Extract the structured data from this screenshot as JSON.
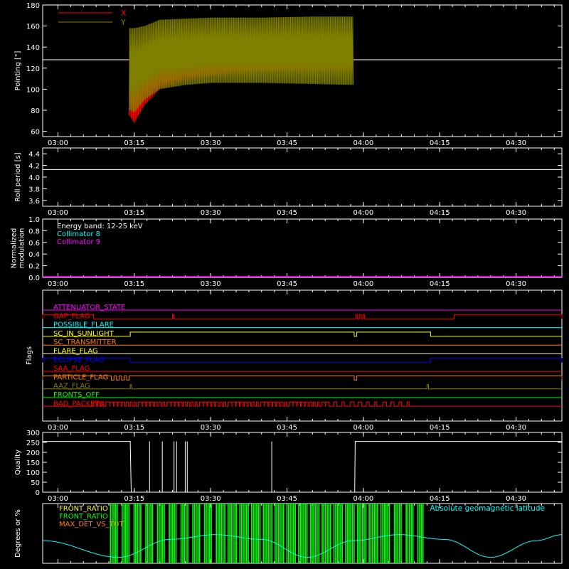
{
  "colors": {
    "background": "#000000",
    "axes": "#ffffff",
    "x_pointing": "#ff0000",
    "y_pointing": "#808000",
    "collimator8": "#00ffff",
    "collimator9": "#ff00ff",
    "front_ratio_1": "#ffff00",
    "front_ratio_2": "#00ff00",
    "max_det": "#ff8000",
    "geomag": "#00ffff"
  },
  "time_ticks": [
    "03:00",
    "03:15",
    "03:30",
    "03:45",
    "04:00",
    "04:15",
    "04:30"
  ],
  "chart_data": [
    {
      "type": "line",
      "ylabel": "Pointing [\"]",
      "ylim": [
        55,
        180
      ],
      "yticks": [
        "60",
        "80",
        "100",
        "120",
        "140",
        "160",
        "180"
      ],
      "legend": [
        {
          "name": "X",
          "color": "#ff0000"
        },
        {
          "name": "Y",
          "color": "#808000"
        }
      ],
      "reference_line": 128,
      "series": [
        {
          "name": "X",
          "x": [
            "03:14",
            "03:15",
            "03:17",
            "03:20",
            "03:25",
            "03:30",
            "03:40",
            "03:50",
            "03:58"
          ],
          "min": [
            75,
            68,
            85,
            100,
            108,
            112,
            116,
            117,
            118
          ],
          "max": [
            150,
            115,
            120,
            124,
            128,
            130,
            132,
            134,
            136
          ]
        },
        {
          "name": "Y",
          "x": [
            "03:14",
            "03:15",
            "03:17",
            "03:20",
            "03:25",
            "03:30",
            "03:40",
            "03:50",
            "03:58"
          ],
          "min": [
            80,
            78,
            90,
            100,
            104,
            106,
            106,
            105,
            104
          ],
          "max": [
            158,
            158,
            160,
            166,
            167,
            168,
            168,
            169,
            169
          ]
        }
      ]
    },
    {
      "type": "line",
      "ylabel": "Roll period [s]",
      "ylim": [
        3.5,
        4.5
      ],
      "yticks": [
        "3.6",
        "3.8",
        "4.0",
        "4.2",
        "4.4"
      ],
      "series": [
        {
          "name": "Roll period",
          "x": [
            "02:57",
            "04:39"
          ],
          "values": [
            4.13,
            4.13
          ]
        }
      ]
    },
    {
      "type": "line",
      "ylabel": [
        "Normalized",
        "modulation"
      ],
      "ylim": [
        0,
        1
      ],
      "yticks": [
        "0.0",
        "0.2",
        "0.4",
        "0.6",
        "0.8",
        "1.0"
      ],
      "annotations": [
        "Energy band: 12-25 keV",
        "Collimator 8",
        "Collimator 9"
      ],
      "series": [
        {
          "name": "Collimator 9",
          "x": [
            "02:57",
            "04:39"
          ],
          "values": [
            0,
            0
          ]
        }
      ]
    },
    {
      "type": "line",
      "ylabel": "Flags",
      "flags": [
        {
          "name": "ATTENUATOR_STATE",
          "color": "#ff00ff",
          "pulses": []
        },
        {
          "name": "GAP_FLAG",
          "color": "#ff0000",
          "pulses": [
            [
              "02:57",
              "03:07"
            ],
            [
              "03:22.5",
              "03:22.8"
            ],
            [
              "03:58.5",
              "03:58.8"
            ],
            [
              "03:59.3",
              "03:59.6"
            ],
            [
              "03:59.9",
              "04:00.2"
            ],
            [
              "04:17.8",
              "04:39"
            ]
          ]
        },
        {
          "name": "POSSIBLE_FLARE",
          "color": "#00ffff",
          "pulses": []
        },
        {
          "name": "SC_IN_SUNLIGHT",
          "color": "#ffff00",
          "pulses": [
            [
              "03:14.2",
              "03:58.2"
            ],
            [
              "03:58.7",
              "04:13.2"
            ]
          ]
        },
        {
          "name": "SC_TRANSMITTER",
          "color": "#ff8000",
          "pulses": []
        },
        {
          "name": "FLARE_FLAG",
          "color": "#ffff00",
          "pulses": []
        },
        {
          "name": "ECLIPSE_FLAG",
          "color": "#0000ff",
          "pulses": [
            [
              "02:57",
              "03:14.2"
            ],
            [
              "04:13.2",
              "04:39"
            ]
          ]
        },
        {
          "name": "SAA_FLAG",
          "color": "#ff0000",
          "pulses": []
        },
        {
          "name": "PARTICLE_FLAG",
          "color": "#ff8000",
          "pulses": [
            [
              "02:57",
              "03:10.5"
            ],
            [
              "03:11",
              "03:11.5"
            ],
            [
              "03:12",
              "03:12.5"
            ],
            [
              "03:13",
              "03:13.5"
            ],
            [
              "03:14",
              "03:58.2"
            ],
            [
              "03:58.7",
              "04:39"
            ]
          ]
        },
        {
          "name": "AAZ_FLAG",
          "color": "#808000",
          "pulses": [
            [
              "03:14.2",
              "03:14.5"
            ],
            [
              "04:12.5",
              "04:12.8"
            ]
          ]
        },
        {
          "name": "FRONTS_OFF",
          "color": "#00ff00",
          "pulses": []
        },
        {
          "name": "BAD_PACKETS",
          "color": "#ff0000",
          "pulses": "dense_03:07_04:09"
        }
      ]
    },
    {
      "type": "line",
      "ylabel": "Quality",
      "ylim": [
        0,
        300
      ],
      "yticks": [
        "0",
        "50",
        "100",
        "150",
        "200",
        "250",
        "300"
      ],
      "series": [
        {
          "name": "Quality",
          "x": [
            "02:57",
            "03:14.2",
            "03:14.4",
            "03:58.3",
            "03:58.4",
            "04:39"
          ],
          "values": [
            255,
            255,
            0,
            0,
            255,
            255
          ]
        }
      ],
      "spikes": [
        "03:18",
        "03:20.5",
        "03:22.8",
        "03:23.3",
        "03:25",
        "03:25.4",
        "03:42"
      ]
    },
    {
      "type": "line",
      "ylabel": "Degrees or %",
      "ylim": [
        0,
        100
      ],
      "legend": [
        {
          "name": "FRONT_RATIO",
          "color": "#ffff00"
        },
        {
          "name": "FRONT_RATIO",
          "color": "#00ff00"
        },
        {
          "name": "MAX_DET_VS_TOT",
          "color": "#ff8000"
        }
      ],
      "annotation": "Absolute geomagnetic latitude",
      "series": [
        {
          "name": "Absolute geomagnetic latitude",
          "x": [
            "02:57",
            "03:12",
            "03:22",
            "03:31",
            "03:40",
            "03:49",
            "03:58",
            "04:07",
            "04:16",
            "04:25",
            "04:34",
            "04:39"
          ],
          "values": [
            38,
            10,
            40,
            48,
            40,
            10,
            38,
            48,
            40,
            10,
            38,
            48
          ]
        }
      ]
    }
  ]
}
